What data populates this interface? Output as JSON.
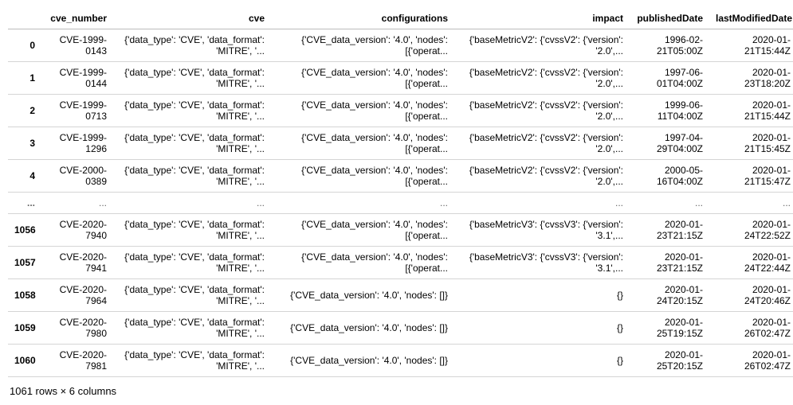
{
  "headers": {
    "idx": "",
    "cve_number": "cve_number",
    "cve": "cve",
    "configurations": "configurations",
    "impact": "impact",
    "publishedDate": "publishedDate",
    "lastModifiedDate": "lastModifiedDate"
  },
  "rows": [
    {
      "idx": "0",
      "cve_number": "CVE-1999-0143",
      "cve": "{'data_type': 'CVE', 'data_format': 'MITRE', '...",
      "configurations": "{'CVE_data_version': '4.0', 'nodes': [{'operat...",
      "impact": "{'baseMetricV2': {'cvssV2': {'version': '2.0',...",
      "publishedDate": "1996-02-21T05:00Z",
      "lastModifiedDate": "2020-01-21T15:44Z"
    },
    {
      "idx": "1",
      "cve_number": "CVE-1999-0144",
      "cve": "{'data_type': 'CVE', 'data_format': 'MITRE', '...",
      "configurations": "{'CVE_data_version': '4.0', 'nodes': [{'operat...",
      "impact": "{'baseMetricV2': {'cvssV2': {'version': '2.0',...",
      "publishedDate": "1997-06-01T04:00Z",
      "lastModifiedDate": "2020-01-23T18:20Z"
    },
    {
      "idx": "2",
      "cve_number": "CVE-1999-0713",
      "cve": "{'data_type': 'CVE', 'data_format': 'MITRE', '...",
      "configurations": "{'CVE_data_version': '4.0', 'nodes': [{'operat...",
      "impact": "{'baseMetricV2': {'cvssV2': {'version': '2.0',...",
      "publishedDate": "1999-06-11T04:00Z",
      "lastModifiedDate": "2020-01-21T15:44Z"
    },
    {
      "idx": "3",
      "cve_number": "CVE-1999-1296",
      "cve": "{'data_type': 'CVE', 'data_format': 'MITRE', '...",
      "configurations": "{'CVE_data_version': '4.0', 'nodes': [{'operat...",
      "impact": "{'baseMetricV2': {'cvssV2': {'version': '2.0',...",
      "publishedDate": "1997-04-29T04:00Z",
      "lastModifiedDate": "2020-01-21T15:45Z"
    },
    {
      "idx": "4",
      "cve_number": "CVE-2000-0389",
      "cve": "{'data_type': 'CVE', 'data_format': 'MITRE', '...",
      "configurations": "{'CVE_data_version': '4.0', 'nodes': [{'operat...",
      "impact": "{'baseMetricV2': {'cvssV2': {'version': '2.0',...",
      "publishedDate": "2000-05-16T04:00Z",
      "lastModifiedDate": "2020-01-21T15:47Z"
    }
  ],
  "rows2": [
    {
      "idx": "1056",
      "cve_number": "CVE-2020-7940",
      "cve": "{'data_type': 'CVE', 'data_format': 'MITRE', '...",
      "configurations": "{'CVE_data_version': '4.0', 'nodes': [{'operat...",
      "impact": "{'baseMetricV3': {'cvssV3': {'version': '3.1',...",
      "publishedDate": "2020-01-23T21:15Z",
      "lastModifiedDate": "2020-01-24T22:52Z"
    },
    {
      "idx": "1057",
      "cve_number": "CVE-2020-7941",
      "cve": "{'data_type': 'CVE', 'data_format': 'MITRE', '...",
      "configurations": "{'CVE_data_version': '4.0', 'nodes': [{'operat...",
      "impact": "{'baseMetricV3': {'cvssV3': {'version': '3.1',...",
      "publishedDate": "2020-01-23T21:15Z",
      "lastModifiedDate": "2020-01-24T22:44Z"
    },
    {
      "idx": "1058",
      "cve_number": "CVE-2020-7964",
      "cve": "{'data_type': 'CVE', 'data_format': 'MITRE', '...",
      "configurations": "{'CVE_data_version': '4.0', 'nodes': []}",
      "impact": "{}",
      "publishedDate": "2020-01-24T20:15Z",
      "lastModifiedDate": "2020-01-24T20:46Z"
    },
    {
      "idx": "1059",
      "cve_number": "CVE-2020-7980",
      "cve": "{'data_type': 'CVE', 'data_format': 'MITRE', '...",
      "configurations": "{'CVE_data_version': '4.0', 'nodes': []}",
      "impact": "{}",
      "publishedDate": "2020-01-25T19:15Z",
      "lastModifiedDate": "2020-01-26T02:47Z"
    },
    {
      "idx": "1060",
      "cve_number": "CVE-2020-7981",
      "cve": "{'data_type': 'CVE', 'data_format': 'MITRE', '...",
      "configurations": "{'CVE_data_version': '4.0', 'nodes': []}",
      "impact": "{}",
      "publishedDate": "2020-01-25T20:15Z",
      "lastModifiedDate": "2020-01-26T02:47Z"
    }
  ],
  "ellipsis": "...",
  "footer": "1061 rows × 6 columns"
}
